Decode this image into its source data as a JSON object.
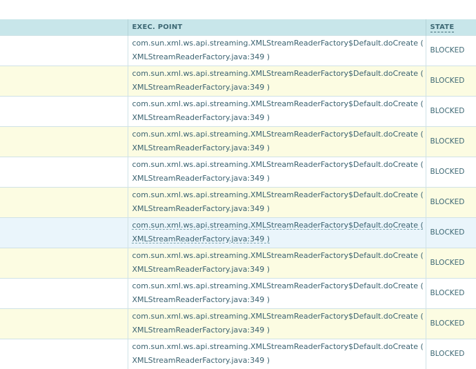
{
  "table": {
    "headers": {
      "blank": "",
      "exec_point": "EXEC. POINT",
      "state": "STATE"
    },
    "rows": [
      {
        "method": "com.sun.xml.ws.api.streaming.XMLStreamReaderFactory$Default.doCreate (",
        "location": "XMLStreamReaderFactory.java:349 )",
        "state": "BLOCKED"
      },
      {
        "method": "com.sun.xml.ws.api.streaming.XMLStreamReaderFactory$Default.doCreate (",
        "location": "XMLStreamReaderFactory.java:349 )",
        "state": "BLOCKED"
      },
      {
        "method": "com.sun.xml.ws.api.streaming.XMLStreamReaderFactory$Default.doCreate (",
        "location": "XMLStreamReaderFactory.java:349 )",
        "state": "BLOCKED"
      },
      {
        "method": "com.sun.xml.ws.api.streaming.XMLStreamReaderFactory$Default.doCreate (",
        "location": "XMLStreamReaderFactory.java:349 )",
        "state": "BLOCKED"
      },
      {
        "method": "com.sun.xml.ws.api.streaming.XMLStreamReaderFactory$Default.doCreate (",
        "location": "XMLStreamReaderFactory.java:349 )",
        "state": "BLOCKED"
      },
      {
        "method": "com.sun.xml.ws.api.streaming.XMLStreamReaderFactory$Default.doCreate (",
        "location": "XMLStreamReaderFactory.java:349 )",
        "state": "BLOCKED"
      },
      {
        "method": "com.sun.xml.ws.api.streaming.XMLStreamReaderFactory$Default.doCreate (",
        "location": "XMLStreamReaderFactory.java:349 )",
        "state": "BLOCKED"
      },
      {
        "method": "com.sun.xml.ws.api.streaming.XMLStreamReaderFactory$Default.doCreate (",
        "location": "XMLStreamReaderFactory.java:349 )",
        "state": "BLOCKED"
      },
      {
        "method": "com.sun.xml.ws.api.streaming.XMLStreamReaderFactory$Default.doCreate (",
        "location": "XMLStreamReaderFactory.java:349 )",
        "state": "BLOCKED"
      },
      {
        "method": "com.sun.xml.ws.api.streaming.XMLStreamReaderFactory$Default.doCreate (",
        "location": "XMLStreamReaderFactory.java:349 )",
        "state": "BLOCKED"
      },
      {
        "method": "com.sun.xml.ws.api.streaming.XMLStreamReaderFactory$Default.doCreate (",
        "location": "XMLStreamReaderFactory.java:349 )",
        "state": "BLOCKED"
      }
    ]
  }
}
